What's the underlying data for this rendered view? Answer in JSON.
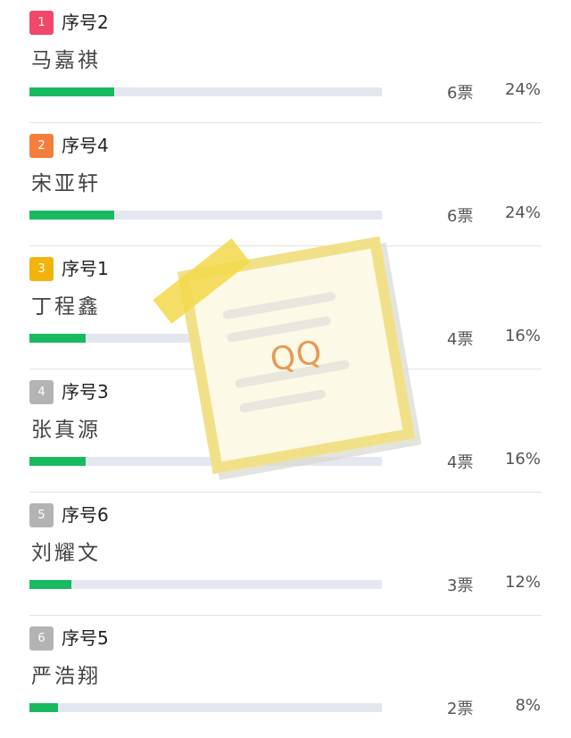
{
  "colors": {
    "rank_1": "#f2476a",
    "rank_2": "#f57e3c",
    "rank_3": "#f2b40b",
    "rank_other": "#b3b3b3",
    "progress_fill": "#19b960",
    "progress_track": "#e4e7ef"
  },
  "candidates": [
    {
      "rank": "1",
      "seq": "序号2",
      "name": "马嘉祺",
      "votes": "6票",
      "percent": "24%",
      "share": 0.24
    },
    {
      "rank": "2",
      "seq": "序号4",
      "name": "宋亚轩",
      "votes": "6票",
      "percent": "24%",
      "share": 0.24
    },
    {
      "rank": "3",
      "seq": "序号1",
      "name": "丁程鑫",
      "votes": "4票",
      "percent": "16%",
      "share": 0.16
    },
    {
      "rank": "4",
      "seq": "序号3",
      "name": "张真源",
      "votes": "4票",
      "percent": "16%",
      "share": 0.16
    },
    {
      "rank": "5",
      "seq": "序号6",
      "name": "刘耀文",
      "votes": "3票",
      "percent": "12%",
      "share": 0.12
    },
    {
      "rank": "6",
      "seq": "序号5",
      "name": "严浩翔",
      "votes": "2票",
      "percent": "8%",
      "share": 0.08
    }
  ],
  "overlay": {
    "logo_text": "QQ",
    "icon": "sticky-note-icon"
  }
}
